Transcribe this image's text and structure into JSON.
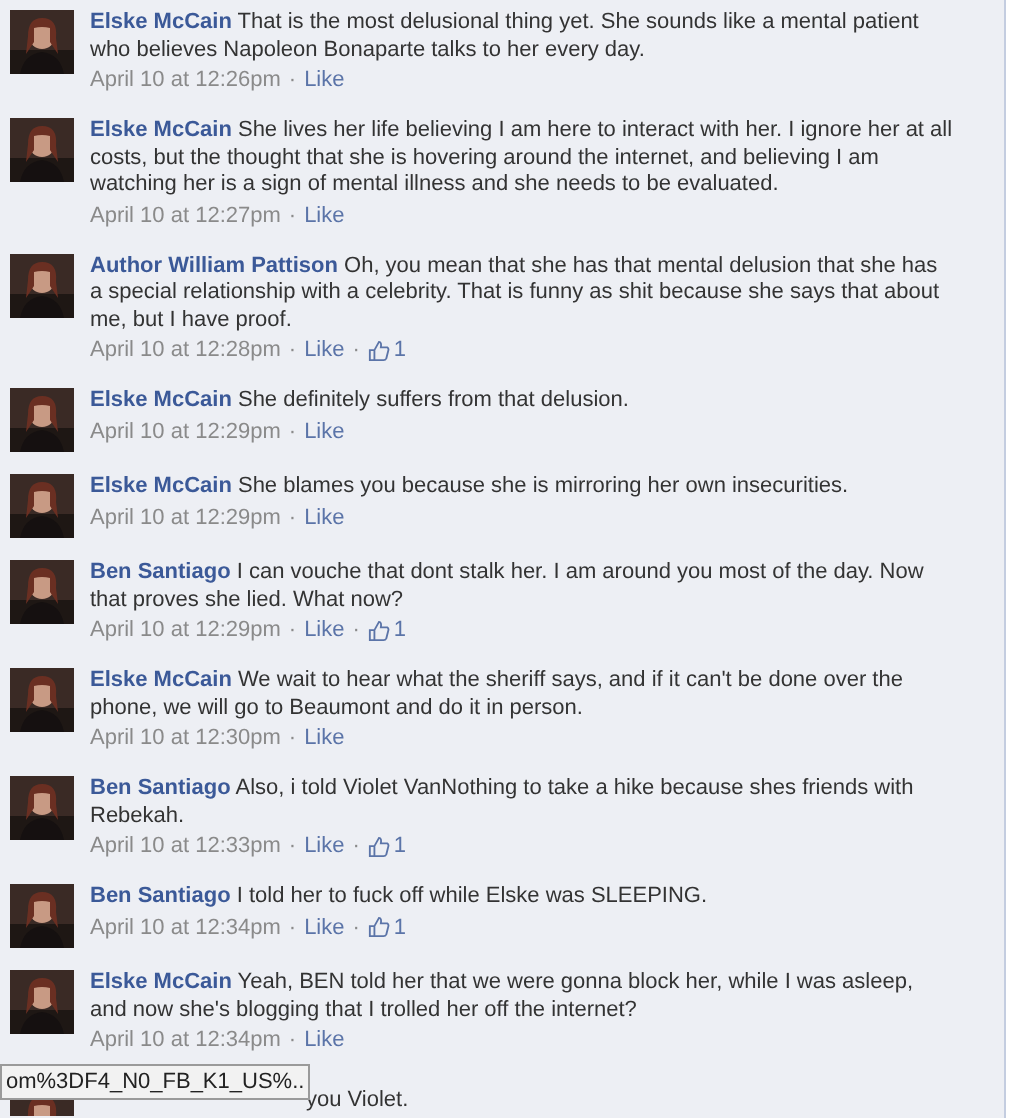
{
  "comments": [
    {
      "author": "Elske McCain",
      "text": "That is the most delusional thing yet. She sounds like a mental patient who believes Napoleon Bonaparte talks to her every day.",
      "time": "April 10 at 12:26pm",
      "separators": [
        "·"
      ],
      "action": "Like"
    },
    {
      "author": "Elske McCain",
      "text": "She lives her life believing I am here to interact with her. I ignore her at all costs, but the thought that she is hovering around the internet, and believing I am watching her is a sign of mental illness and she needs to be evaluated.",
      "time": "April 10 at 12:27pm",
      "separators": [
        "·"
      ],
      "action": "Like"
    },
    {
      "author": "Author William Pattison",
      "text": "Oh, you mean that she has that mental delusion that she has a special relationship with a celebrity. That is funny as shit because she says that about me, but I have proof.",
      "time": "April 10 at 12:28pm",
      "separators": [
        "·",
        "·"
      ],
      "action": "Like",
      "likes": "1"
    },
    {
      "author": "Elske McCain",
      "text": "She definitely suffers from that delusion.",
      "time": "April 10 at 12:29pm",
      "separators": [
        "·"
      ],
      "action": "Like"
    },
    {
      "author": "Elske McCain",
      "text": "She blames you because she is mirroring her own insecurities.",
      "time": "April 10 at 12:29pm",
      "separators": [
        "·"
      ],
      "action": "Like"
    },
    {
      "author": "Ben Santiago",
      "text": "I can vouche that dont stalk her. I am around you most of the day. Now that proves she lied. What now?",
      "time": "April 10 at 12:29pm",
      "separators": [
        "·",
        "·"
      ],
      "action": "Like",
      "likes": "1"
    },
    {
      "author": "Elske McCain",
      "text": "We wait to hear what the sheriff says, and if it can't be done over the phone, we will go to Beaumont and do it in person.",
      "time": "April 10 at 12:30pm",
      "separators": [
        "·"
      ],
      "action": "Like"
    },
    {
      "author": "Ben Santiago",
      "text": "Also, i told Violet VanNothing to take a hike because shes friends with Rebekah.",
      "time": "April 10 at 12:33pm",
      "separators": [
        "·",
        "·"
      ],
      "action": "Like",
      "likes": "1"
    },
    {
      "author": "Ben Santiago",
      "text": "I told her to fuck off while Elske was SLEEPING.",
      "time": "April 10 at 12:34pm",
      "separators": [
        "·",
        "·"
      ],
      "action": "Like",
      "likes": "1"
    },
    {
      "author": "Elske McCain",
      "text": "Yeah, BEN told her that we were gonna block her, while I was asleep, and now she's blogging that I trolled her off the internet?",
      "time": "April 10 at 12:34pm",
      "separators": [
        "·"
      ],
      "action": "Like"
    }
  ],
  "partial_comment": {
    "text": "you Violet."
  },
  "status_tooltip": {
    "url": "om%3DF4_N0_FB_K1_US%.."
  }
}
